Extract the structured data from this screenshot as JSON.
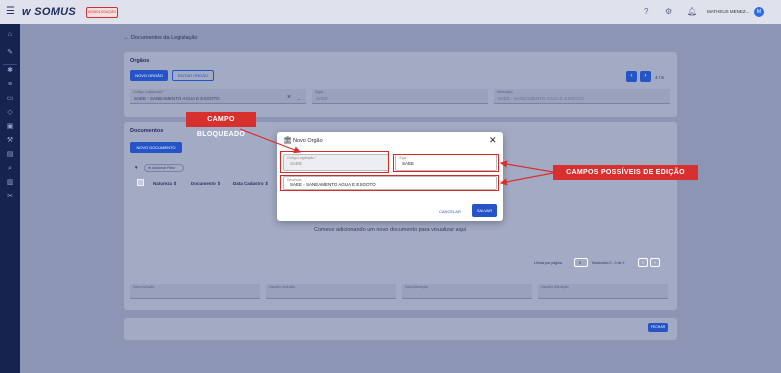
{
  "topbar": {
    "menu_icon": "hamburger-icon",
    "logo": "SOMUS",
    "env_badge": "HOMOLOGAÇÃO",
    "user_name": "MATHEUS MENEZ...",
    "avatar": "M"
  },
  "page": {
    "back_label": "Documentos da Legislação"
  },
  "orgaos": {
    "title": "Orgãos",
    "new_button": "NOVO ORGÃO",
    "edit_button": "EDITAR ORGÃO",
    "pager": "4 / 6",
    "fields": {
      "codigo_label": "Código Legislação *",
      "codigo_value": "SAEE - SANEAMENTO AGUA E ESGOTO",
      "sigla_label": "Sigla",
      "sigla_value": "SAEE",
      "descricao_label": "Descrição",
      "descricao_value": "SAEE - SANEAMENTO AGUA E ESGOTO"
    }
  },
  "documentos": {
    "title": "Documentos",
    "new_button": "NOVO DOCUMENTO",
    "filter_chip": "Adicionar Filtro",
    "columns": [
      "Natureza",
      "Documento",
      "Data Cadastro"
    ],
    "empty_message": "Comece adicionando um novo documento para visualizar aqui",
    "rows_per_page_label": "Linhas por página",
    "rows_per_page_value": "5",
    "range": "Mostrando 0 - 0 de 0"
  },
  "audit": {
    "data_inclusao_label": "Data Inclusão",
    "data_inclusao_value": "-",
    "usuario_inclusao_label": "Usuário Inclusão",
    "usuario_inclusao_value": "-",
    "data_alteracao_label": "Data Alteração",
    "data_alteracao_value": "-",
    "usuario_alteracao_label": "Usuário Alteração",
    "usuario_alteracao_value": "-"
  },
  "footer": {
    "close_button": "FECHAR"
  },
  "modal": {
    "title": "Novo Orgão",
    "codigo_label": "Código Legislação *",
    "codigo_value": "SAEE",
    "sigla_label": "Sigla *",
    "sigla_value": "SAEE",
    "descricao_label": "Descrição",
    "descricao_value": "SAEE - SANEAMENTO AGUA E ESGOTO",
    "cancel_button": "CANCELAR",
    "save_button": "SALVAR"
  },
  "annotations": {
    "blocked": "CAMPO BLOQUEADO",
    "editable": "CAMPOS POSSÍVEIS DE EDIÇÃO"
  },
  "colors": {
    "accent": "#2554c7",
    "annotation_red": "#d8302f",
    "sidebar": "#16234f"
  }
}
